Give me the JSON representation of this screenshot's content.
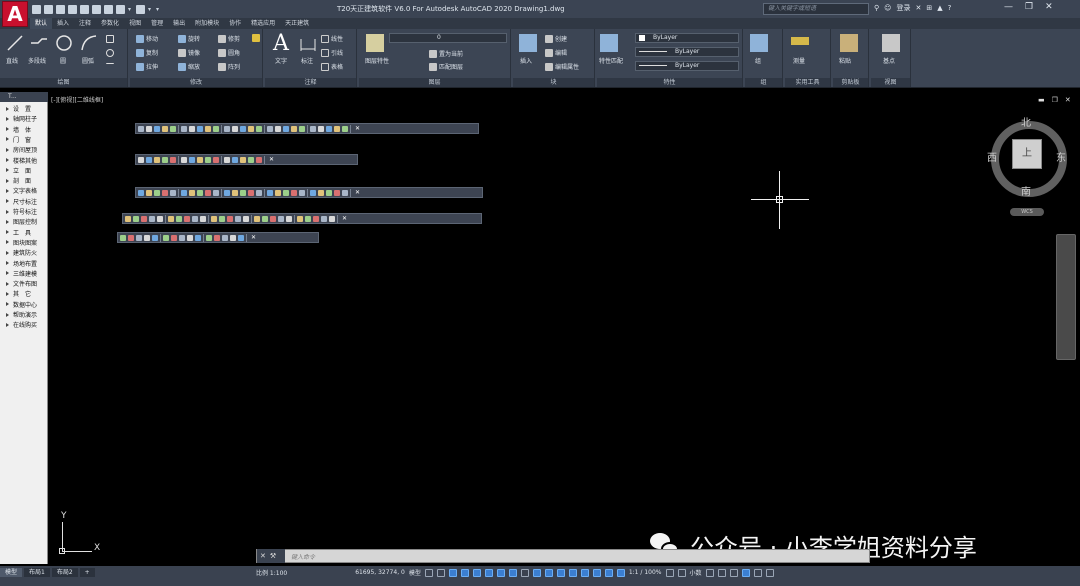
{
  "app": {
    "logo_letter": "A",
    "title": "T20天正建筑软件 V6.0 For Autodesk AutoCAD 2020    Drawing1.dwg",
    "search_placeholder": "键入关键字或短语",
    "login_label": "登录"
  },
  "ribbon_tabs": [
    "默认",
    "插入",
    "注释",
    "参数化",
    "视图",
    "管理",
    "输出",
    "附加模块",
    "协作",
    "精选应用",
    "天正建筑"
  ],
  "ribbon": {
    "draw": {
      "label": "绘图",
      "tools": [
        "直线",
        "多段线",
        "圆",
        "圆弧"
      ]
    },
    "modify": {
      "label": "修改",
      "tools": [
        "移动",
        "旋转",
        "修剪",
        "复制",
        "镜像",
        "圆角",
        "拉伸",
        "缩放",
        "阵列"
      ]
    },
    "annotation": {
      "label": "注释",
      "tools": [
        "文字",
        "标注",
        "线性",
        "引线",
        "表格"
      ]
    },
    "layers": {
      "label": "图层",
      "tools": [
        "图层特性",
        "置为当前",
        "匹配图层"
      ],
      "current_layer": "0"
    },
    "block": {
      "label": "块",
      "tools": [
        "插入",
        "创建",
        "编辑",
        "编辑属性"
      ]
    },
    "properties": {
      "label": "特性",
      "tools": [
        "特性匹配"
      ],
      "color": "ByLayer",
      "linetype": "ByLayer",
      "lineweight": "ByLayer"
    },
    "groups": {
      "label": "组",
      "tools": [
        "组"
      ]
    },
    "utilities": {
      "label": "实用工具",
      "tools": [
        "测量"
      ]
    },
    "clipboard": {
      "label": "剪贴板",
      "tools": [
        "粘贴"
      ]
    },
    "view": {
      "label": "视图",
      "tools": [
        "基点"
      ]
    }
  },
  "palette": {
    "title": "T...",
    "items": [
      "设　置",
      "轴网柱子",
      "墙　体",
      "门　窗",
      "房间屋顶",
      "楼梯其他",
      "立　面",
      "剖　面",
      "文字表格",
      "尺寸标注",
      "符号标注",
      "图层控制",
      "工　具",
      "图块图案",
      "建筑防火",
      "场地布置",
      "三维建模",
      "文件布图",
      "其　它",
      "数据中心",
      "帮助演示",
      "在线购买"
    ]
  },
  "viewport": {
    "label": "[-][俯视][二维线框]"
  },
  "viewcube": {
    "north": "北",
    "south": "南",
    "east": "东",
    "west": "西",
    "face": "上",
    "wcs": "WCS"
  },
  "ucs": {
    "x": "X",
    "y": "Y"
  },
  "watermark": "公众号 · 小李学姐资料分享",
  "command": {
    "placeholder": "键入命令"
  },
  "layout_tabs": [
    "模型",
    "布局1",
    "布局2"
  ],
  "status": {
    "scale": "比例 1:100",
    "coords": "61695, 32774, 0",
    "model": "模型",
    "zoom": "1:1 / 100%",
    "units": "小数"
  }
}
